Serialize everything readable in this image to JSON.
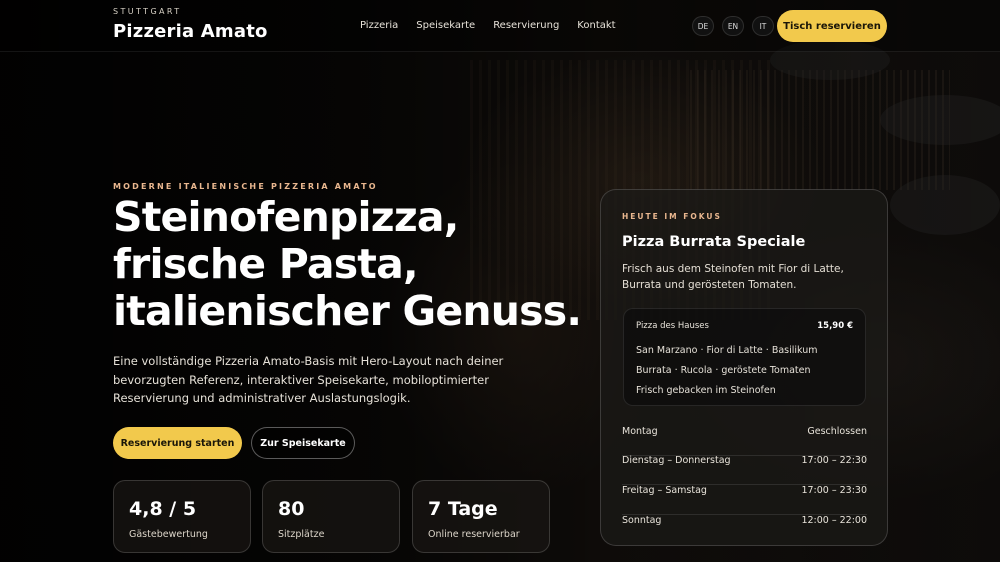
{
  "header": {
    "city": "STUTTGART",
    "brand": "Pizzeria Amato",
    "nav": [
      "Pizzeria",
      "Speisekarte",
      "Reservierung",
      "Kontakt"
    ],
    "languages": [
      "DE",
      "EN",
      "IT"
    ],
    "cta": "Tisch reservieren"
  },
  "hero": {
    "eyebrow": "MODERNE ITALIENISCHE PIZZERIA AMATO",
    "title_lines": [
      "Steinofenpizza,",
      "frische Pasta,",
      "italienischer Genuss."
    ],
    "text": "Eine vollständige Pizzeria Amato-Basis mit Hero-Layout nach deiner bevorzugten Referenz, interaktiver Speisekarte, mobiloptimierter Reservierung und administrativer Auslastungslogik.",
    "primary_button": "Reservierung starten",
    "secondary_button": "Zur Speisekarte",
    "stats": [
      {
        "value": "4,8 / 5",
        "label": "Gästebewertung"
      },
      {
        "value": "80",
        "label": "Sitzplätze"
      },
      {
        "value": "7 Tage",
        "label": "Online reservierbar"
      }
    ]
  },
  "focus": {
    "eyebrow": "HEUTE IM FOKUS",
    "title": "Pizza Burrata Speciale",
    "description": "Frisch aus dem Steinofen mit Fior di Latte, Burrata und gerösteten Tomaten.",
    "item_name": "Pizza des Hauses",
    "item_price": "15,90 €",
    "ingredients": [
      "San Marzano · Fior di Latte · Basilikum",
      "Burrata · Rucola · geröstete Tomaten",
      "Frisch gebacken im Steinofen"
    ],
    "hours": [
      {
        "day": "Montag",
        "time": "Geschlossen"
      },
      {
        "day": "Dienstag – Donnerstag",
        "time": "17:00 – 22:30"
      },
      {
        "day": "Freitag – Samstag",
        "time": "17:00 – 23:30"
      },
      {
        "day": "Sonntag",
        "time": "12:00 – 22:00"
      }
    ]
  },
  "colors": {
    "accent": "#f2c94c",
    "eyebrow": "#e9b78f"
  }
}
